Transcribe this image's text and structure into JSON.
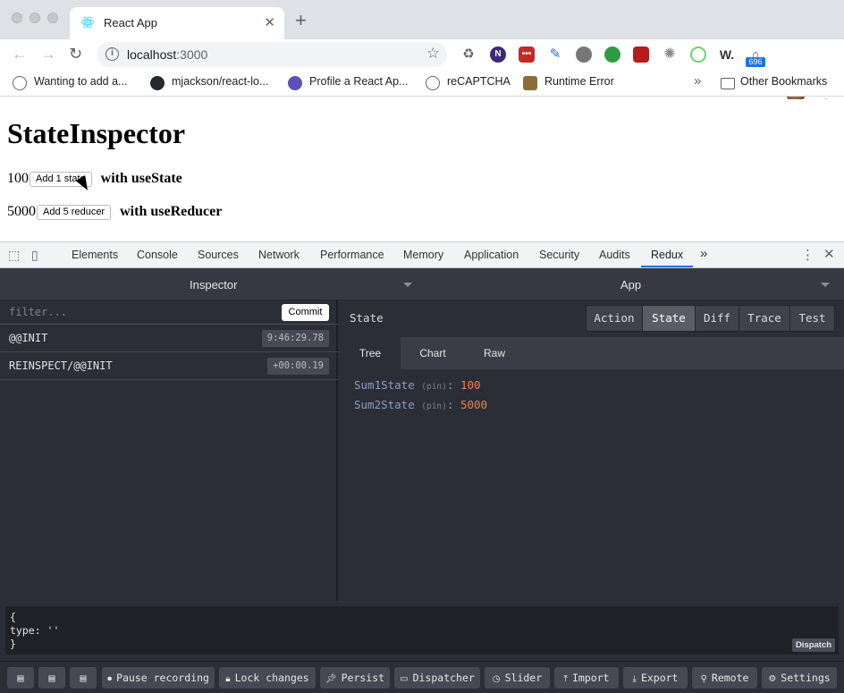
{
  "browser": {
    "tab_title": "React App",
    "tab_close": "✕",
    "new_tab": "+",
    "url_host": "localhost",
    "url_port": ":3000",
    "extension_badge": "696",
    "bookmarks": [
      {
        "label": "Wanting to add a..."
      },
      {
        "label": "mjackson/react-lo..."
      },
      {
        "label": "Profile a React Ap..."
      },
      {
        "label": "reCAPTCHA"
      },
      {
        "label": "Runtime Error"
      }
    ],
    "bookmarks_overflow": "»",
    "other_bookmarks": "Other Bookmarks"
  },
  "page": {
    "heading": "StateInspector",
    "row1": {
      "value": "100",
      "button": "Add 1 state",
      "label": "with useState"
    },
    "row2": {
      "value": "5000",
      "button": "Add 5 reducer",
      "label": "with useReducer"
    }
  },
  "devtools": {
    "tabs": [
      "Elements",
      "Console",
      "Sources",
      "Network",
      "Performance",
      "Memory",
      "Application",
      "Security",
      "Audits",
      "Redux"
    ],
    "active_tab": "Redux",
    "more": "»"
  },
  "redux": {
    "monitor": "Inspector",
    "instance": "App",
    "filter_placeholder": "filter...",
    "commit": "Commit",
    "actions": [
      {
        "name": "@@INIT",
        "time": "9:46:29.78"
      },
      {
        "name": "REINSPECT/@@INIT",
        "time": "+00:00.19"
      }
    ],
    "panel_title": "State",
    "modes": [
      "Action",
      "State",
      "Diff",
      "Trace",
      "Test"
    ],
    "active_mode": "State",
    "subtabs": [
      "Tree",
      "Chart",
      "Raw"
    ],
    "active_subtab": "Tree",
    "state": [
      {
        "key": "Sum1State",
        "pin": "(pin)",
        "value": "100"
      },
      {
        "key": "Sum2State",
        "pin": "(pin)",
        "value": "5000"
      }
    ],
    "dispatch_text": "{\ntype: ''\n}",
    "dispatch_button": "Dispatch",
    "bottom_buttons": [
      {
        "label": "Pause recording",
        "icon": "record-icon"
      },
      {
        "label": "Lock changes",
        "icon": "lock-icon"
      },
      {
        "label": "Persist",
        "icon": "pin-icon"
      },
      {
        "label": "Dispatcher",
        "icon": "dispatcher-icon"
      },
      {
        "label": "Slider",
        "icon": "clock-icon"
      },
      {
        "label": "Import",
        "icon": "upload-icon"
      },
      {
        "label": "Export",
        "icon": "download-icon"
      },
      {
        "label": "Remote",
        "icon": "antenna-icon"
      },
      {
        "label": "Settings",
        "icon": "gear-icon"
      }
    ]
  }
}
